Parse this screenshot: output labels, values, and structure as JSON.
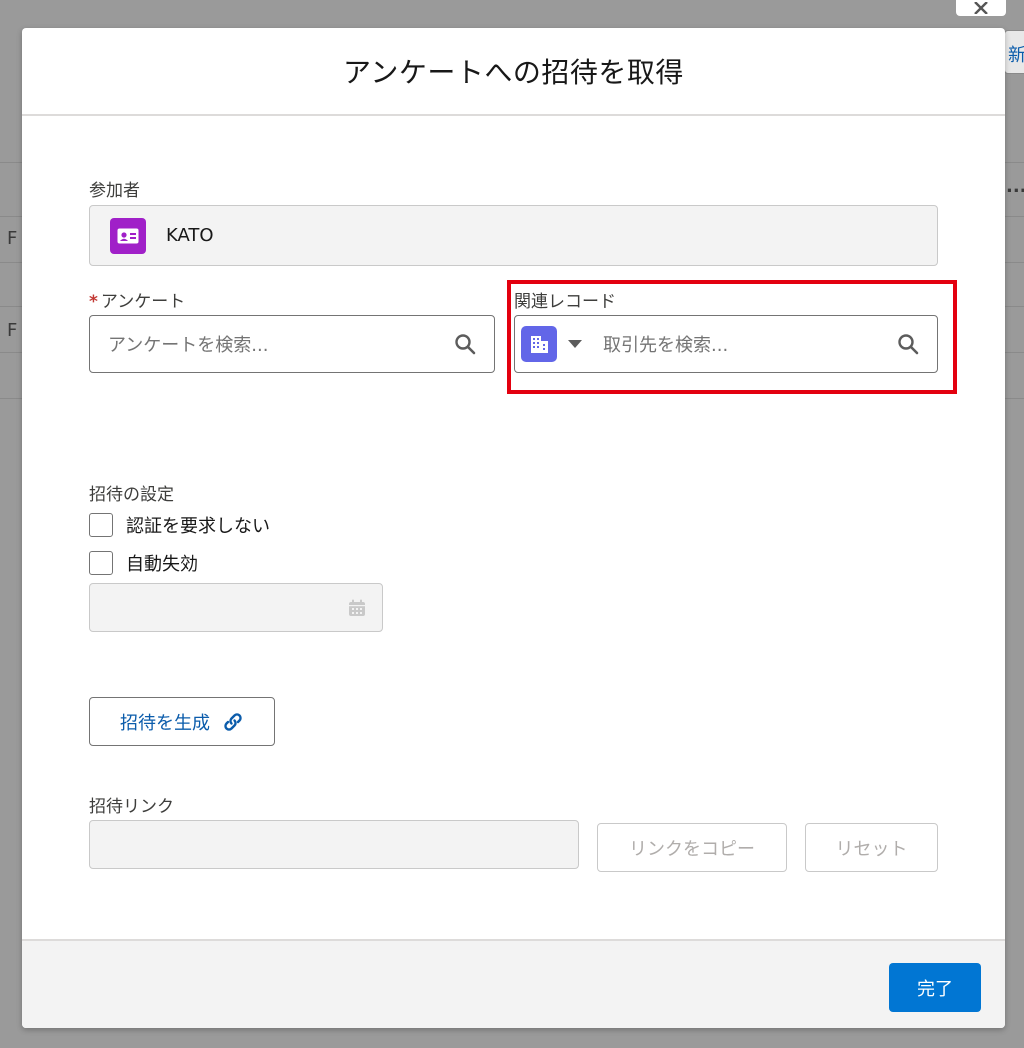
{
  "background": {
    "new_button_label": "新",
    "row_fragment_1": "I F",
    "row_fragment_2": "I F",
    "more_label": "..."
  },
  "modal": {
    "title": "アンケートへの招待を取得",
    "participant": {
      "label": "参加者",
      "value": "KATO",
      "icon": "contact-card-icon"
    },
    "survey": {
      "required_mark": "*",
      "label": "アンケート",
      "placeholder": "アンケートを検索..."
    },
    "related_record": {
      "label": "関連レコード",
      "placeholder": "取引先を検索...",
      "object_icon": "account-building-icon"
    },
    "invitation_settings": {
      "label": "招待の設定",
      "no_auth_label": "認証を要求しない",
      "auto_expire_label": "自動失効"
    },
    "generate_button_label": "招待を生成",
    "invitation_link": {
      "label": "招待リンク",
      "copy_label": "リンクをコピー",
      "reset_label": "リセット"
    },
    "done_label": "完了"
  },
  "colors": {
    "brand_blue": "#0176d3",
    "link_blue": "#0b5cab",
    "contact_purple": "#a020c8",
    "account_indigo": "#6266e8",
    "highlight_red": "#e3000f",
    "required_red": "#c23934"
  }
}
